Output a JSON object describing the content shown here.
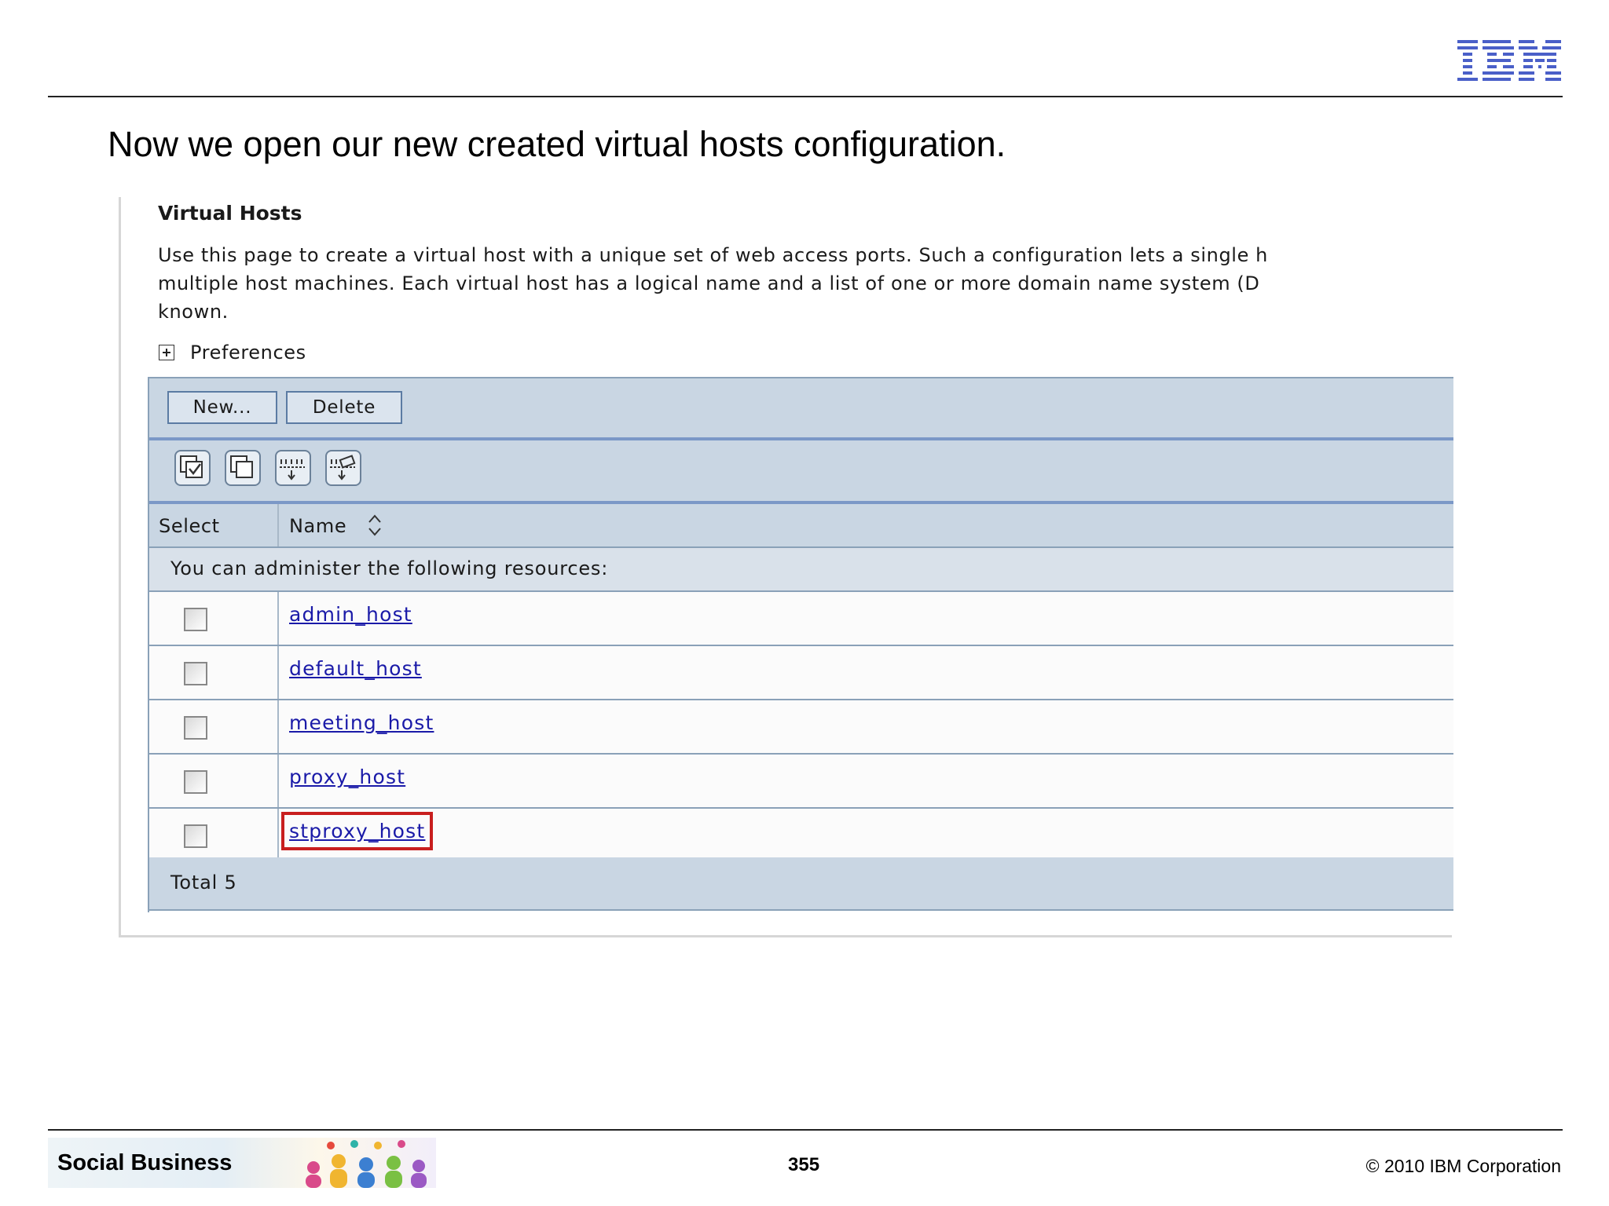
{
  "slide": {
    "title": "Now we open our new created virtual hosts configuration.",
    "page_number": "355",
    "copyright": "© 2010 IBM Corporation",
    "footer_brand": "Social Business",
    "logo": "IBM"
  },
  "virtual_hosts": {
    "heading": "Virtual Hosts",
    "description": "Use this page to create a virtual host with a unique set of web access ports. Such a configuration lets a single h\nmultiple host machines. Each virtual host has a logical name and a list of one or more domain name system (D\nknown.",
    "preferences_label": "Preferences",
    "buttons": {
      "new": "New...",
      "delete": "Delete"
    },
    "toolbar_icons": [
      "select-all-icon",
      "deselect-all-icon",
      "show-filter-icon",
      "clear-filter-icon"
    ],
    "columns": {
      "select": "Select",
      "name": "Name"
    },
    "admin_message": "You can administer the following resources:",
    "rows": [
      {
        "name": "admin_host",
        "checked": false
      },
      {
        "name": "default_host",
        "checked": false
      },
      {
        "name": "meeting_host",
        "checked": false
      },
      {
        "name": "proxy_host",
        "checked": false
      },
      {
        "name": "stproxy_host",
        "checked": false,
        "highlighted": true
      }
    ],
    "total": "Total 5"
  },
  "colors": {
    "highlight": "#c81e1e",
    "link": "#1a1aa8",
    "table_header": "#c9d6e3",
    "logo": "#4a5fc8"
  }
}
